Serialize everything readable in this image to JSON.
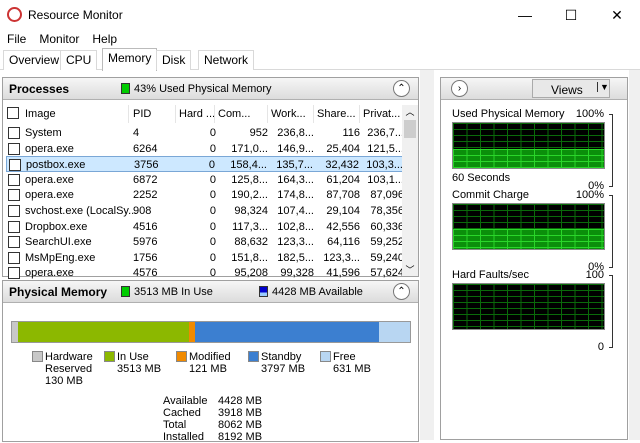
{
  "window": {
    "title": "Resource Monitor",
    "minimize": "—",
    "maximize": "☐",
    "close": "✕"
  },
  "menu": [
    "File",
    "Monitor",
    "Help"
  ],
  "tabs": [
    "Overview",
    "CPU",
    "Memory",
    "Disk",
    "Network"
  ],
  "processes": {
    "title": "Processes",
    "status": "43% Used Physical Memory",
    "columns": [
      "Image",
      "PID",
      "Hard ...",
      "Com...",
      "Work...",
      "Share...",
      "Privat..."
    ],
    "rows": [
      [
        "System",
        "4",
        "0",
        "952",
        "236,8...",
        "116",
        "236,7..."
      ],
      [
        "opera.exe",
        "6264",
        "0",
        "171,0...",
        "146,9...",
        "25,404",
        "121,5..."
      ],
      [
        "postbox.exe",
        "3756",
        "0",
        "158,4...",
        "135,7...",
        "32,432",
        "103,3..."
      ],
      [
        "opera.exe",
        "6872",
        "0",
        "125,8...",
        "164,3...",
        "61,204",
        "103,1..."
      ],
      [
        "opera.exe",
        "2252",
        "0",
        "190,2...",
        "174,8...",
        "87,708",
        "87,096"
      ],
      [
        "svchost.exe (LocalSy...",
        "908",
        "0",
        "98,324",
        "107,4...",
        "29,104",
        "78,356"
      ],
      [
        "Dropbox.exe",
        "4516",
        "0",
        "117,3...",
        "102,8...",
        "42,556",
        "60,336"
      ],
      [
        "SearchUI.exe",
        "5976",
        "0",
        "88,632",
        "123,3...",
        "64,116",
        "59,252"
      ],
      [
        "MsMpEng.exe",
        "1756",
        "0",
        "151,8...",
        "182,5...",
        "123,3...",
        "59,240"
      ],
      [
        "opera.exe",
        "4576",
        "0",
        "95,208",
        "99,328",
        "41,596",
        "57,624"
      ]
    ],
    "selected_index": 2
  },
  "physical": {
    "title": "Physical Memory",
    "in_use_status": "3513 MB In Use",
    "available_status": "4428 MB Available",
    "legend": [
      {
        "label": "Hardware\nReserved",
        "value": "130 MB",
        "color": "#c8c8c8",
        "mb": 130
      },
      {
        "label": "In Use",
        "value": "3513 MB",
        "color": "#8cb800",
        "mb": 3513
      },
      {
        "label": "Modified",
        "value": "121 MB",
        "color": "#f08a00",
        "mb": 121
      },
      {
        "label": "Standby",
        "value": "3797 MB",
        "color": "#3c7fd0",
        "mb": 3797
      },
      {
        "label": "Free",
        "value": "631 MB",
        "color": "#b8d6f2",
        "mb": 631
      }
    ],
    "stats": [
      [
        "Available",
        "4428 MB"
      ],
      [
        "Cached",
        "3918 MB"
      ],
      [
        "Total",
        "8062 MB"
      ],
      [
        "Installed",
        "8192 MB"
      ]
    ]
  },
  "right": {
    "views": "Views",
    "graphs": [
      {
        "title": "Used Physical Memory",
        "max": "100%",
        "min": "0%",
        "footer": "60 Seconds",
        "fill_percent": 43
      },
      {
        "title": "Commit Charge",
        "max": "100%",
        "min": "0%",
        "footer": "",
        "fill_percent": 45
      },
      {
        "title": "Hard Faults/sec",
        "max": "100",
        "min": "0",
        "footer": "",
        "fill_percent": 0
      }
    ]
  }
}
